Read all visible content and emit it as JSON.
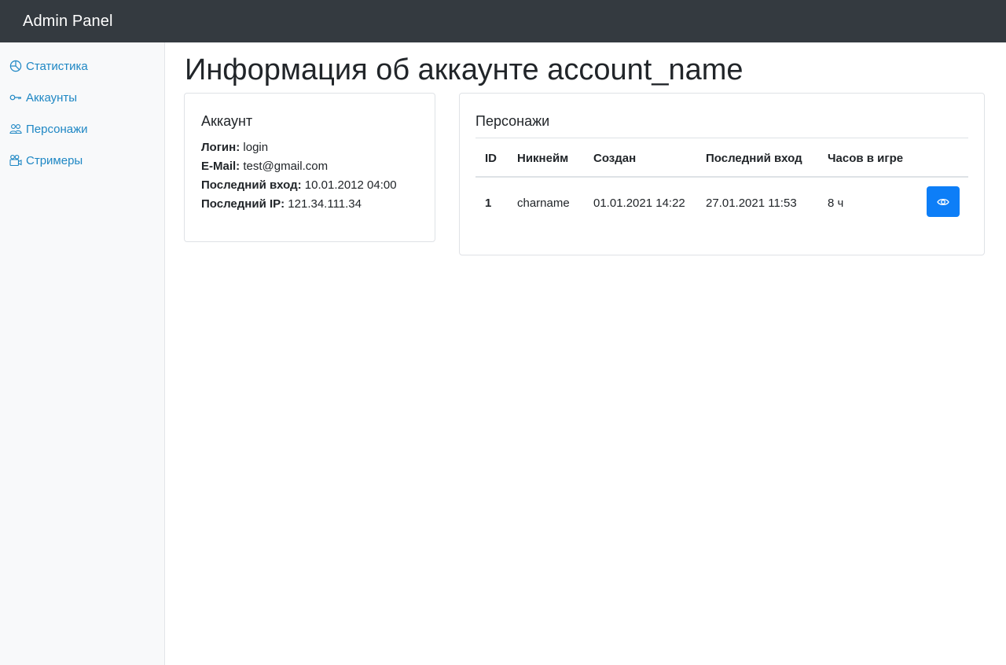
{
  "navbar": {
    "brand": "Admin Panel"
  },
  "sidebar": {
    "items": [
      {
        "label": "Статистика",
        "icon": "pie-chart-icon"
      },
      {
        "label": "Аккаунты",
        "icon": "key-icon"
      },
      {
        "label": "Персонажи",
        "icon": "people-icon"
      },
      {
        "label": "Стримеры",
        "icon": "camera-reels-icon"
      }
    ]
  },
  "main": {
    "title": "Информация об аккаунте account_name",
    "account_card": {
      "title": "Аккаунт",
      "fields": [
        {
          "label": "Логин:",
          "value": "login"
        },
        {
          "label": "E-Mail:",
          "value": "test@gmail.com"
        },
        {
          "label": "Последний вход:",
          "value": "10.01.2012 04:00"
        },
        {
          "label": "Последний IP:",
          "value": "121.34.111.34"
        }
      ]
    },
    "characters_card": {
      "title": "Персонажи",
      "columns": [
        "ID",
        "Никнейм",
        "Создан",
        "Последний вход",
        "Часов в игре"
      ],
      "rows": [
        {
          "id": "1",
          "nickname": "charname",
          "created": "01.01.2021 14:22",
          "last_login": "27.01.2021 11:53",
          "hours": "8 ч",
          "action_icon": "eye-icon"
        }
      ]
    }
  },
  "colors": {
    "navbar": "#343a40",
    "sidebar": "#f8f9fa",
    "link": "#1e87c4",
    "primary_button": "#0d7ef7"
  }
}
